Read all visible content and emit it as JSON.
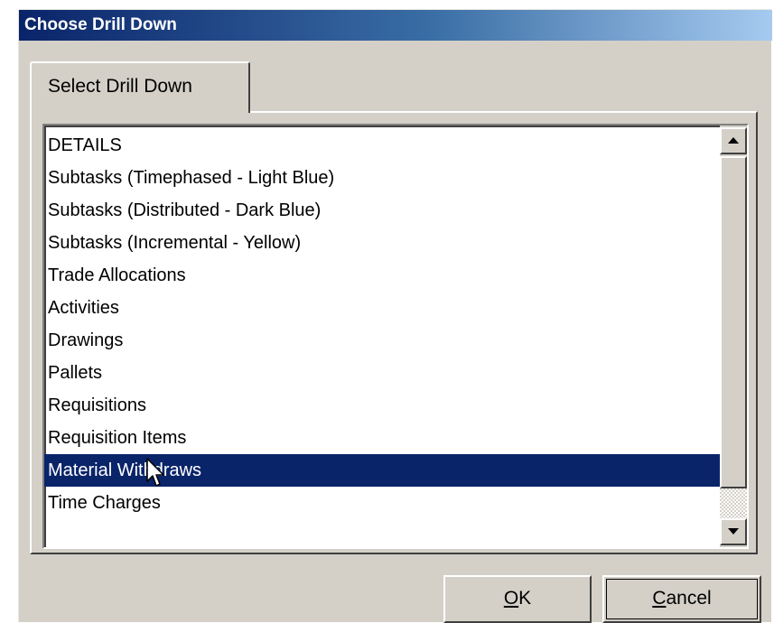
{
  "window": {
    "title": "Choose Drill Down"
  },
  "tabs": [
    {
      "label": "Select Drill Down",
      "active": true
    }
  ],
  "list": {
    "items": [
      "DETAILS",
      "Subtasks (Timephased - Light Blue)",
      "Subtasks (Distributed - Dark Blue)",
      "Subtasks (Incremental - Yellow)",
      "Trade Allocations",
      "Activities",
      "Drawings",
      "Pallets",
      "Requisitions",
      "Requisition Items",
      "Material Withdraws",
      "Time Charges"
    ],
    "selected_index": 10
  },
  "buttons": {
    "ok": {
      "accel": "O",
      "rest": "K"
    },
    "cancel": {
      "accel": "C",
      "rest": "ancel"
    }
  },
  "colors": {
    "selection": "#0a246a",
    "titlebar_start": "#0a246a",
    "titlebar_end": "#a6caf0",
    "face": "#d4d0c8"
  },
  "icons": [
    "scroll-up-arrow-icon",
    "scroll-down-arrow-icon",
    "mouse-pointer-icon"
  ]
}
